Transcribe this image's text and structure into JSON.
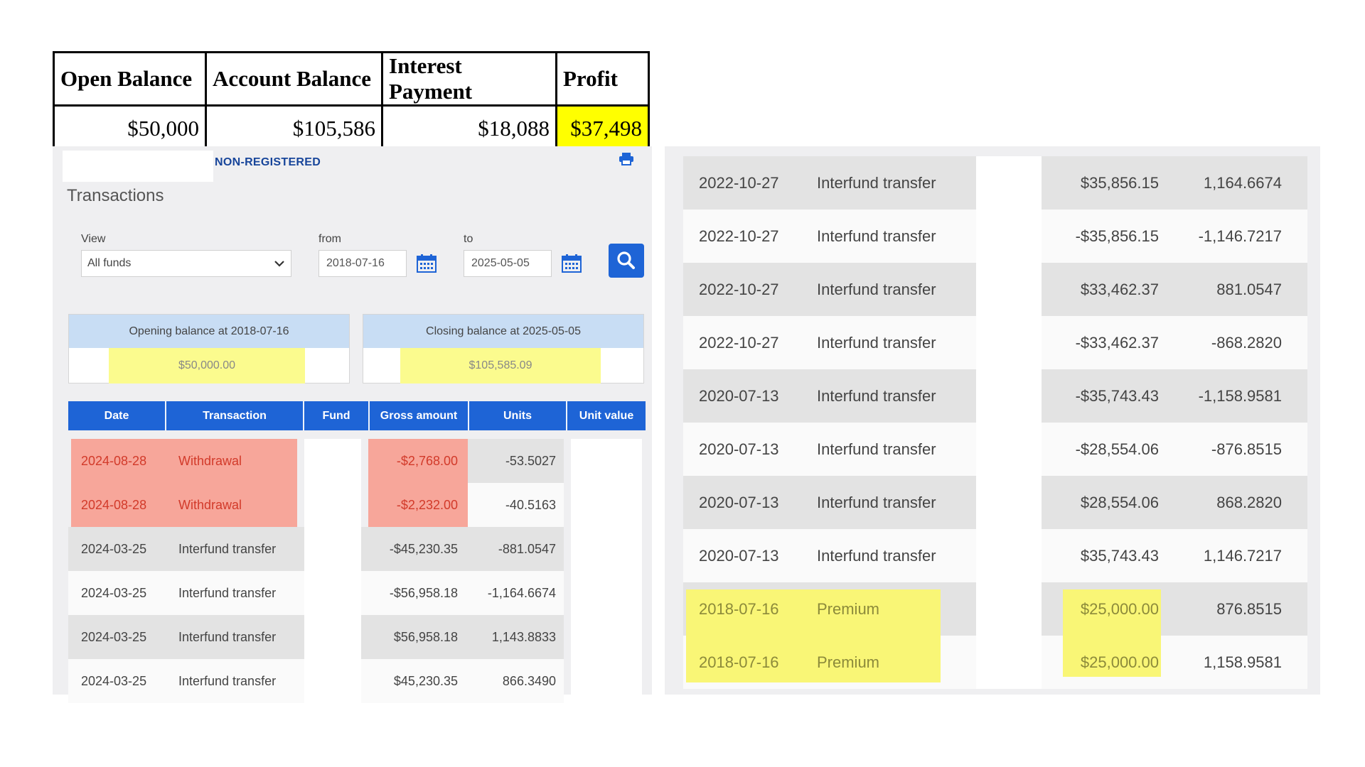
{
  "summary": {
    "headers": [
      "Open Balance",
      "Account Balance",
      "Interest Payment",
      "Profit"
    ],
    "values": [
      "$50,000",
      "$105,586",
      "$18,088",
      "$37,498"
    ],
    "highlight_color": "#ffff00"
  },
  "left_panel": {
    "account_type": "NON-REGISTERED",
    "title": "Transactions",
    "view_label": "View",
    "view_value": "All funds",
    "from_label": "from",
    "from_value": "2018-07-16",
    "to_label": "to",
    "to_value": "2025-05-05",
    "icons": {
      "print": "print-icon",
      "calendar": "calendar-icon",
      "search": "search-icon",
      "dropdown": "chevron-down-icon"
    },
    "opening_balance": {
      "label": "Opening balance at 2018-07-16",
      "value": "$50,000.00"
    },
    "closing_balance": {
      "label": "Closing balance at 2025-05-05",
      "value": "$105,585.09"
    },
    "columns": [
      "Date",
      "Transaction",
      "Fund",
      "Gross amount",
      "Units",
      "Unit value"
    ],
    "rows": [
      {
        "date": "2024-08-28",
        "transaction": "Withdrawal",
        "gross": "-$2,768.00",
        "units": "-53.5027"
      },
      {
        "date": "2024-08-28",
        "transaction": "Withdrawal",
        "gross": "-$2,232.00",
        "units": "-40.5163"
      },
      {
        "date": "2024-03-25",
        "transaction": "Interfund transfer",
        "gross": "-$45,230.35",
        "units": "-881.0547"
      },
      {
        "date": "2024-03-25",
        "transaction": "Interfund transfer",
        "gross": "-$56,958.18",
        "units": "-1,164.6674"
      },
      {
        "date": "2024-03-25",
        "transaction": "Interfund transfer",
        "gross": "$56,958.18",
        "units": "1,143.8833"
      },
      {
        "date": "2024-03-25",
        "transaction": "Interfund transfer",
        "gross": "$45,230.35",
        "units": "866.3490"
      }
    ],
    "colors": {
      "header_blue": "#1e64d6",
      "withdrawal_highlight": "#f7a69a",
      "balance_highlight": "#fbfb8e"
    }
  },
  "right_panel": {
    "rows": [
      {
        "date": "2022-10-27",
        "transaction": "Interfund transfer",
        "gross": "$35,856.15",
        "units": "1,164.6674"
      },
      {
        "date": "2022-10-27",
        "transaction": "Interfund transfer",
        "gross": "-$35,856.15",
        "units": "-1,146.7217"
      },
      {
        "date": "2022-10-27",
        "transaction": "Interfund transfer",
        "gross": "$33,462.37",
        "units": "881.0547"
      },
      {
        "date": "2022-10-27",
        "transaction": "Interfund transfer",
        "gross": "-$33,462.37",
        "units": "-868.2820"
      },
      {
        "date": "2020-07-13",
        "transaction": "Interfund transfer",
        "gross": "-$35,743.43",
        "units": "-1,158.9581"
      },
      {
        "date": "2020-07-13",
        "transaction": "Interfund transfer",
        "gross": "-$28,554.06",
        "units": "-876.8515"
      },
      {
        "date": "2020-07-13",
        "transaction": "Interfund transfer",
        "gross": "$28,554.06",
        "units": "868.2820"
      },
      {
        "date": "2020-07-13",
        "transaction": "Interfund transfer",
        "gross": "$35,743.43",
        "units": "1,146.7217"
      },
      {
        "date": "2018-07-16",
        "transaction": "Premium",
        "gross": "$25,000.00",
        "units": "876.8515"
      },
      {
        "date": "2018-07-16",
        "transaction": "Premium",
        "gross": "$25,000.00",
        "units": "1,158.9581"
      }
    ],
    "colors": {
      "premium_highlight": "#f9f676"
    }
  }
}
